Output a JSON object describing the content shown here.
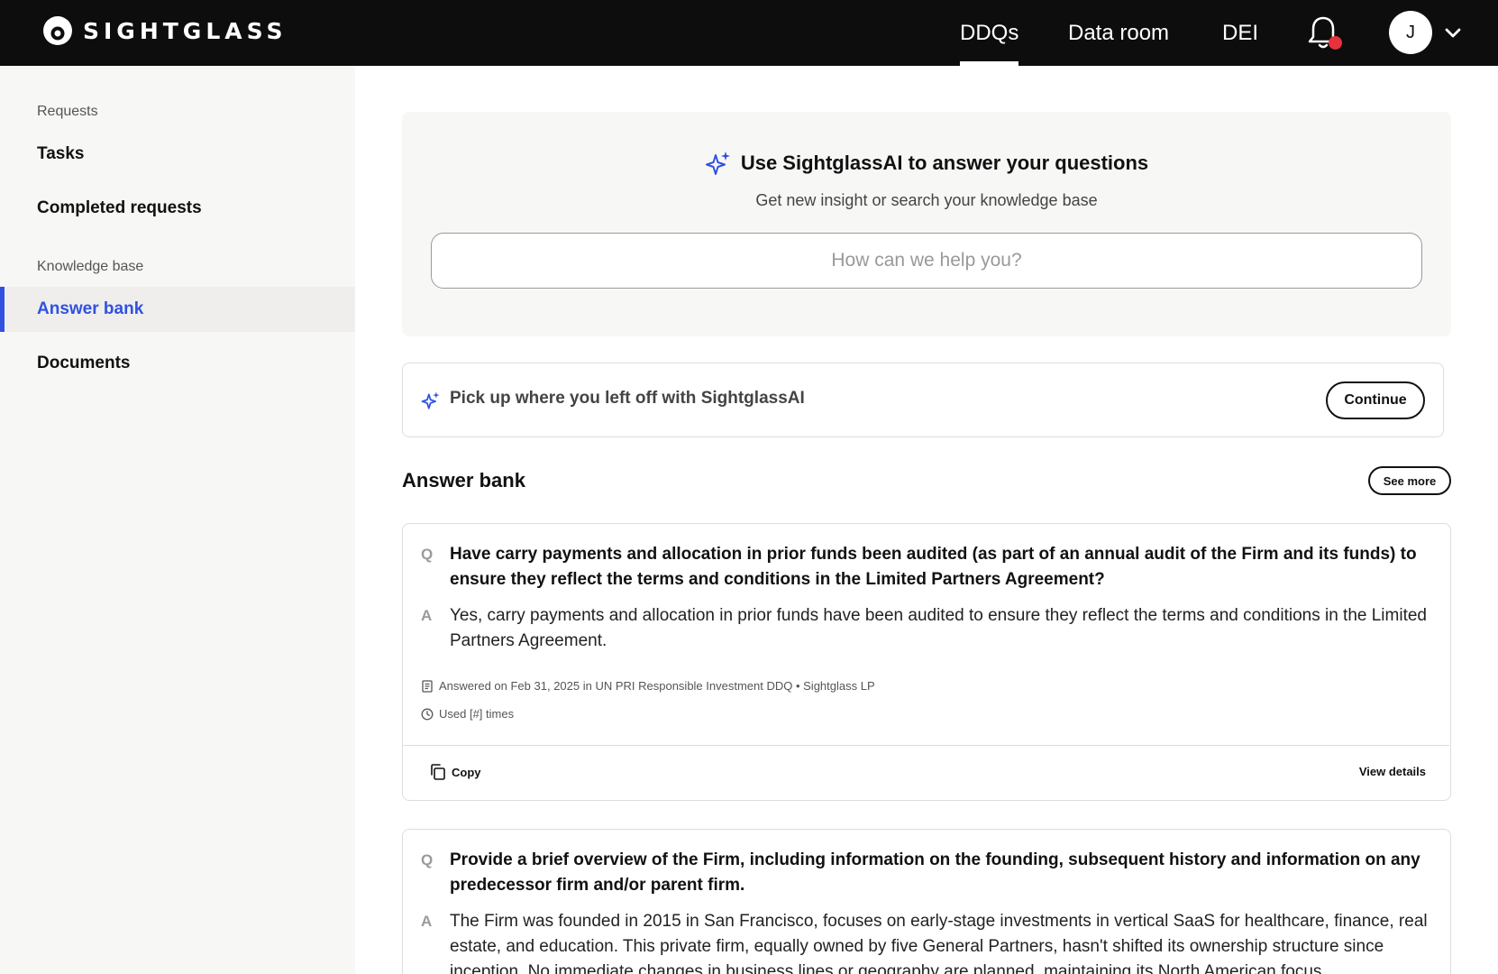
{
  "brand": {
    "name": "SIGHTGLASS"
  },
  "nav": {
    "items": [
      {
        "label": "DDQs",
        "active": true
      },
      {
        "label": "Data room",
        "active": false
      },
      {
        "label": "DEI",
        "active": false
      }
    ],
    "notification_icon": "bell-icon",
    "avatar_initial": "J"
  },
  "sidebar": {
    "sections": [
      {
        "title": "Requests",
        "items": [
          {
            "label": "Tasks"
          },
          {
            "label": "Completed requests"
          }
        ]
      },
      {
        "title": "Knowledge base",
        "items": [
          {
            "label": "Answer bank",
            "active": true
          },
          {
            "label": "Documents"
          }
        ]
      }
    ]
  },
  "ai_card": {
    "title": "Use SightglassAI to answer your questions",
    "subtitle": "Get new insight or search your knowledge base",
    "search_placeholder": "How can we help you?",
    "search_value": ""
  },
  "pickup": {
    "text": "Pick up where you left off with SightglassAI",
    "button_label": "Continue"
  },
  "answer_bank": {
    "title": "Answer bank",
    "see_more_label": "See more",
    "items": [
      {
        "q_letter": "Q",
        "a_letter": "A",
        "question": "Have carry payments and allocation in prior funds been audited (as part of an annual audit of the Firm and its funds) to ensure they reflect the terms and conditions in the Limited Partners Agreement?",
        "answer": "Yes, carry payments and allocation in prior funds have been audited to ensure they reflect the terms and conditions in the Limited Partners Agreement.",
        "answered_meta": "Answered on Feb 31, 2025 in UN PRI Responsible Investment DDQ • Sightglass LP",
        "used_meta": "Used [#] times",
        "copy_label": "Copy",
        "view_details_label": "View details"
      },
      {
        "q_letter": "Q",
        "a_letter": "A",
        "question": "Provide a brief overview of the Firm, including information on the founding, subsequent history and information on any predecessor firm and/or parent firm.",
        "answer": "The Firm was founded in 2015 in San Francisco, focuses on early-stage investments in vertical SaaS for healthcare, finance, real estate, and education. This private firm, equally owned by five General Partners, hasn't shifted its ownership structure since inception. No immediate changes in business lines or geography are planned, maintaining its North American focus."
      }
    ]
  }
}
